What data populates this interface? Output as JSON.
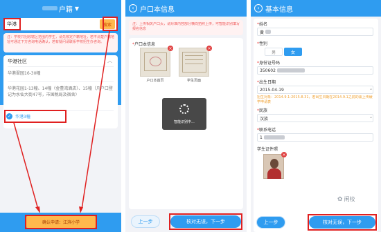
{
  "screen1": {
    "title": "户籍",
    "search_value": "华港",
    "search_button": "搜索",
    "notice": "注：学校只招收辖区范围内学生，请先核定户籍地址，若不清楚户籍地址可通过下方咨询电话确认，若有疑问请联系学校招生办咨询。",
    "community_title": "华港社区",
    "items": [
      "华港翠园16-30幢",
      "华港花园1-13幢、14幢（金董湾酒店）、15幢（凡户口登记为水仙大街47号，市国税局及宿舍）"
    ],
    "selected_item": "华港3幢",
    "confirm_button": "确认申请：江滨小学"
  },
  "screen2": {
    "title": "户口本信息",
    "notice": "注：上传相关户口页，请对准内容部分横向拍照上传，可智能识别填写报名信息",
    "section_label": "户口本信息",
    "photo1_caption": "户口本首页",
    "photo2_caption": "学生页面",
    "loading_text": "智能识别中...",
    "prev_button": "上一步",
    "next_button": "核对无误，下一步"
  },
  "screen3": {
    "title": "基本信息",
    "name_label": "姓名",
    "name_value": "黄",
    "gender_label": "性别",
    "gender_male": "男",
    "gender_female": "女",
    "id_label": "身份证号码",
    "id_value": "350602",
    "birth_label": "出生日期",
    "birth_value": "2015-04-19",
    "birth_note": "招生对象：2014.9.1-2015.8.31，若出生日期在2014.9.1之前的需上传缓学申请表",
    "ethnic_label": "民族",
    "ethnic_value": "汉族",
    "phone_label": "联系电话",
    "phone_value": "1",
    "student_photo_label": "学生证件照",
    "prev_button": "上一步",
    "next_button": "核对无误，下一步",
    "watermark": "闲校"
  },
  "colors": {
    "primary": "#2f9cf0",
    "highlight": "#e02020",
    "notice": "#f05a5a",
    "confirm_orange": "#ffb84d"
  }
}
